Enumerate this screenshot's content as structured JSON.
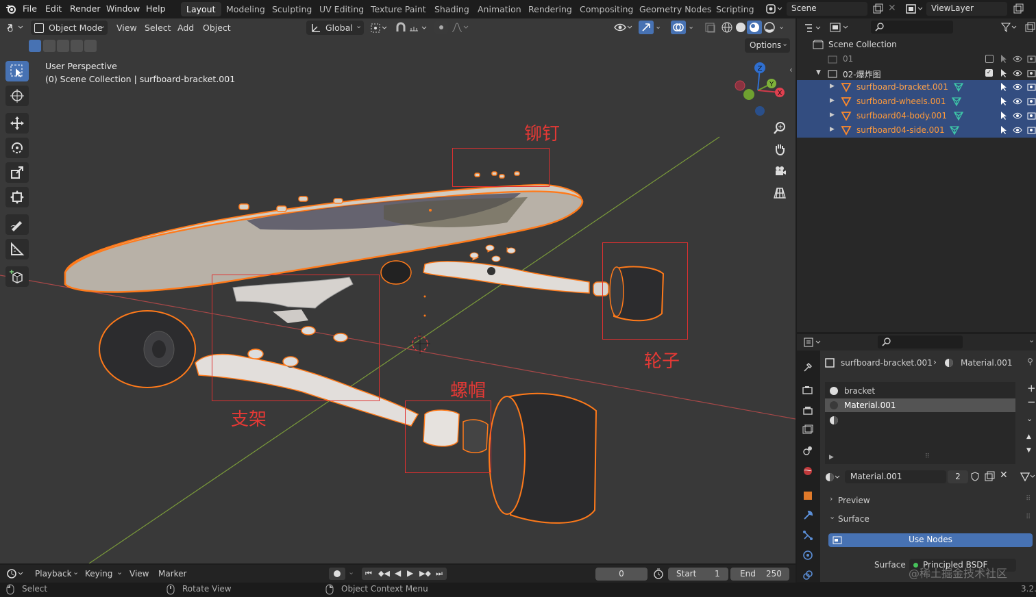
{
  "menu": {
    "items": [
      "File",
      "Edit",
      "Render",
      "Window",
      "Help"
    ]
  },
  "workspaces": [
    "Layout",
    "Modeling",
    "Sculpting",
    "UV Editing",
    "Texture Paint",
    "Shading",
    "Animation",
    "Rendering",
    "Compositing",
    "Geometry Nodes",
    "Scripting"
  ],
  "scene": {
    "name": "Scene",
    "view_layer": "ViewLayer"
  },
  "viewport": {
    "mode": "Object Mode",
    "menus": [
      "View",
      "Select",
      "Add",
      "Object"
    ],
    "transform_orientation": "Global",
    "options_label": "Options",
    "info_line1": "User Perspective",
    "info_line2": "(0) Scene Collection | surfboard-bracket.001",
    "gizmo_axes": {
      "z": "Z",
      "y": "Y",
      "x": "X"
    }
  },
  "annotations": {
    "rivet": "铆钉",
    "wheel": "轮子",
    "nut": "螺帽",
    "bracket": "支架"
  },
  "outliner": {
    "root": "Scene Collection",
    "collections": [
      {
        "name": "01"
      },
      {
        "name": "02-爆炸图"
      }
    ],
    "objects": [
      {
        "name": "surfboard-bracket.001"
      },
      {
        "name": "surfboard-wheels.001"
      },
      {
        "name": "surfboard04-body.001"
      },
      {
        "name": "surfboard04-side.001"
      }
    ]
  },
  "properties": {
    "object_name": "surfboard-bracket.001",
    "material_name": "Material.001",
    "slots": [
      {
        "name": "bracket"
      },
      {
        "name": "Material.001"
      }
    ],
    "material_field": "Material.001",
    "user_count": "2",
    "panel_preview": "Preview",
    "panel_surface": "Surface",
    "use_nodes": "Use Nodes",
    "surface_label": "Surface",
    "surface_value": "Principled BSDF"
  },
  "timeline": {
    "playback": "Playback",
    "keying": "Keying",
    "view": "View",
    "marker": "Marker",
    "current_frame": "0",
    "start_label": "Start",
    "start": "1",
    "end_label": "End",
    "end": "250"
  },
  "statusbar": {
    "select": "Select",
    "rotate": "Rotate View",
    "context": "Object Context Menu",
    "version": "3.2.",
    "watermark": "@稀土掘金技术社区"
  },
  "colors": {
    "accent": "#4772b3",
    "selection_outline": "#ff7a1a",
    "annotation": "#e53935",
    "outliner_selected": "#334d80"
  }
}
